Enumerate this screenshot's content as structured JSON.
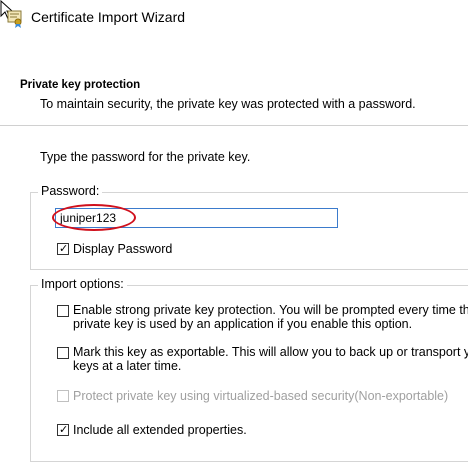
{
  "window": {
    "title": "Certificate Import Wizard",
    "title_icon": "certificate-icon"
  },
  "section": {
    "title": "Private key protection",
    "description": "To maintain security, the private key was protected with a password."
  },
  "instructions": "Type the password for the private key.",
  "password_group": {
    "legend": "Password:",
    "value": "juniper123",
    "display_password": {
      "label": "Display Password",
      "checked": true
    }
  },
  "import_options": {
    "legend": "Import options:",
    "strong_protection": {
      "line1": "Enable strong private key protection. You will be prompted every time the",
      "line2": "private key is used by an application if you enable this option.",
      "checked": false
    },
    "exportable": {
      "line1": "Mark this key as exportable. This will allow you to back up or transport your",
      "line2": "keys at a later time.",
      "checked": false
    },
    "vbs_protection": {
      "label": "Protect private key using virtualized-based security(Non-exportable)",
      "checked": false,
      "disabled": true
    },
    "extended_properties": {
      "label": "Include all extended properties.",
      "checked": true
    }
  },
  "annotation": {
    "highlight_color": "#d0101c"
  },
  "colors": {
    "input_border": "#3b7bcc",
    "group_border": "#d5d5d5",
    "disabled_text": "#a0a0a0"
  }
}
